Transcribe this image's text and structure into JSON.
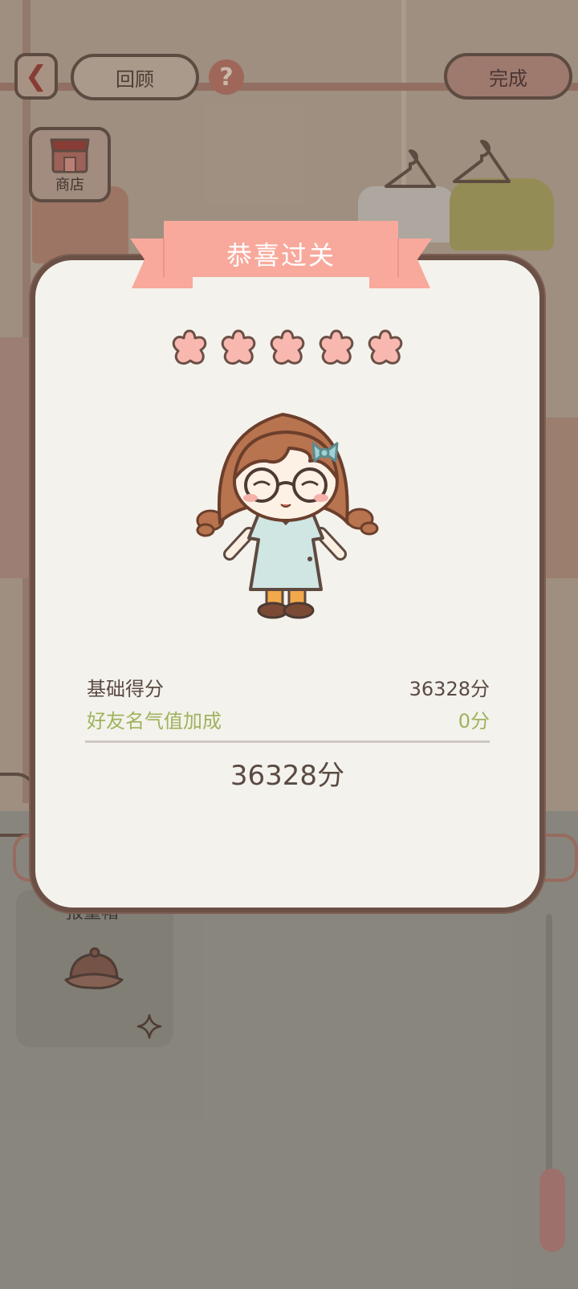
{
  "header": {
    "back_icon": "chevron-left-icon",
    "review_label": "回顾",
    "help_icon": "question-icon",
    "done_label": "完成"
  },
  "shop": {
    "label": "商店",
    "icon": "shop-icon"
  },
  "item": {
    "label": "报童帽",
    "icon": "hat-icon",
    "badge_icon": "sparkle-icon"
  },
  "result": {
    "title": "恭喜过关",
    "stars_earned": 5,
    "stars_total": 5,
    "base_label": "基础得分",
    "base_value": "36328分",
    "bonus_label": "好友名气值加成",
    "bonus_value": "0分",
    "total_value": "36328分"
  },
  "colors": {
    "ribbon": "#f8a99c",
    "star": "#f8b8b0",
    "outline": "#6b5046",
    "bonus_text": "#9eb35e",
    "modal_bg": "#f4f2ec"
  }
}
